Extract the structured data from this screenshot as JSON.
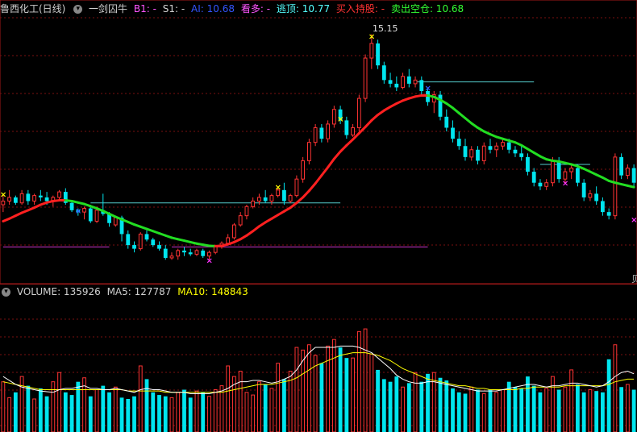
{
  "main_header": {
    "stock_name": "鲁西化工(日线)",
    "indicator_name": "一剑囚牛",
    "b1": "B1: -",
    "s1": "S1: -",
    "ai": "AI: 10.68",
    "kanduo": "看多: -",
    "taoding": "逃顶: 10.77",
    "mairu": "买入持股: -",
    "maichu": "卖出空仓: 10.68",
    "colors": {
      "stock": "#d0d0d0",
      "indicator": "#d0d0d0",
      "b1": "#ff55ff",
      "s1": "#d0d0d0",
      "ai": "#3355ff",
      "kanduo": "#ff55ff",
      "taoding": "#55ffff",
      "mairu": "#ff3333",
      "maichu": "#33ff33"
    }
  },
  "peak_label": "15.15",
  "volume_header": {
    "volume": "VOLUME: 135926",
    "ma5": "MA5: 127787",
    "ma10": "MA10: 148843"
  },
  "right_edge_glyph": "贝",
  "colors": {
    "up": "#ff3333",
    "down": "#00e5ee",
    "ma_red": "#ff2020",
    "ma_green": "#22dd22",
    "grid": "#7a1010",
    "border": "#a01818",
    "ma5": "#ffffff",
    "ma10": "#ffff00"
  },
  "chart_data": {
    "type": "candlestick",
    "y_min": 8.5,
    "y_max": 15.6,
    "candles": [
      [
        10.5,
        10.8,
        10.3,
        10.6
      ],
      [
        10.6,
        10.9,
        10.5,
        10.7
      ],
      [
        10.7,
        10.75,
        10.5,
        10.55
      ],
      [
        10.55,
        10.9,
        10.5,
        10.8
      ],
      [
        10.8,
        10.9,
        10.5,
        10.6
      ],
      [
        10.6,
        10.8,
        10.5,
        10.75
      ],
      [
        10.75,
        10.9,
        10.6,
        10.7
      ],
      [
        10.7,
        10.85,
        10.5,
        10.6
      ],
      [
        10.6,
        10.75,
        10.45,
        10.7
      ],
      [
        10.7,
        10.9,
        10.6,
        10.85
      ],
      [
        10.85,
        10.95,
        10.5,
        10.55
      ],
      [
        10.55,
        10.6,
        10.3,
        10.35
      ],
      [
        10.35,
        10.4,
        10.2,
        10.3
      ],
      [
        10.3,
        10.45,
        10.1,
        10.4
      ],
      [
        10.4,
        10.5,
        10.0,
        10.05
      ],
      [
        10.05,
        10.45,
        10.0,
        10.35
      ],
      [
        10.35,
        10.8,
        10.2,
        10.25
      ],
      [
        10.25,
        10.3,
        9.9,
        10.0
      ],
      [
        9.95,
        10.2,
        9.9,
        10.15
      ],
      [
        10.15,
        10.2,
        9.5,
        9.7
      ],
      [
        9.7,
        9.8,
        9.3,
        9.4
      ],
      [
        9.4,
        9.5,
        9.2,
        9.3
      ],
      [
        9.3,
        9.75,
        9.25,
        9.7
      ],
      [
        9.7,
        9.8,
        9.5,
        9.55
      ],
      [
        9.55,
        9.6,
        9.35,
        9.4
      ],
      [
        9.4,
        9.5,
        9.25,
        9.3
      ],
      [
        9.3,
        9.4,
        9.0,
        9.05
      ],
      [
        9.05,
        9.2,
        9.0,
        9.1
      ],
      [
        9.1,
        9.3,
        9.0,
        9.25
      ],
      [
        9.25,
        9.35,
        9.1,
        9.2
      ],
      [
        9.2,
        9.3,
        9.1,
        9.15
      ],
      [
        9.15,
        9.3,
        9.1,
        9.25
      ],
      [
        9.25,
        9.3,
        9.05,
        9.1
      ],
      [
        9.1,
        9.25,
        9.0,
        9.2
      ],
      [
        9.2,
        9.4,
        9.15,
        9.35
      ],
      [
        9.35,
        9.5,
        9.3,
        9.45
      ],
      [
        9.45,
        9.7,
        9.4,
        9.6
      ],
      [
        9.6,
        10.0,
        9.55,
        9.95
      ],
      [
        9.95,
        10.3,
        9.9,
        10.2
      ],
      [
        10.2,
        10.5,
        10.1,
        10.45
      ],
      [
        10.45,
        10.7,
        10.4,
        10.6
      ],
      [
        10.6,
        10.8,
        10.5,
        10.7
      ],
      [
        10.7,
        10.9,
        10.55,
        10.6
      ],
      [
        10.6,
        10.8,
        10.5,
        10.75
      ],
      [
        10.75,
        11.0,
        10.7,
        10.9
      ],
      [
        10.9,
        11.1,
        10.5,
        10.6
      ],
      [
        10.6,
        10.8,
        10.55,
        10.75
      ],
      [
        10.75,
        11.3,
        10.7,
        11.2
      ],
      [
        11.2,
        11.8,
        11.1,
        11.7
      ],
      [
        11.7,
        12.3,
        11.6,
        12.2
      ],
      [
        12.2,
        12.7,
        12.1,
        12.6
      ],
      [
        12.6,
        12.7,
        12.2,
        12.3
      ],
      [
        12.3,
        12.8,
        12.2,
        12.7
      ],
      [
        12.7,
        13.2,
        12.6,
        13.1
      ],
      [
        13.1,
        13.2,
        12.7,
        12.8
      ],
      [
        12.8,
        12.9,
        12.3,
        12.4
      ],
      [
        12.4,
        12.7,
        12.35,
        12.6
      ],
      [
        12.6,
        13.5,
        12.5,
        13.4
      ],
      [
        13.4,
        14.6,
        13.3,
        14.5
      ],
      [
        14.5,
        15.15,
        14.2,
        14.9
      ],
      [
        14.9,
        15.0,
        14.2,
        14.3
      ],
      [
        14.3,
        14.4,
        13.8,
        13.9
      ],
      [
        13.9,
        14.1,
        13.7,
        13.8
      ],
      [
        13.8,
        14.0,
        13.6,
        13.7
      ],
      [
        13.7,
        14.1,
        13.65,
        14.0
      ],
      [
        14.0,
        14.2,
        13.7,
        13.8
      ],
      [
        13.8,
        14.0,
        13.7,
        13.9
      ],
      [
        13.9,
        14.0,
        13.5,
        13.6
      ],
      [
        13.6,
        13.7,
        13.2,
        13.3
      ],
      [
        13.3,
        13.6,
        13.0,
        13.5
      ],
      [
        13.5,
        13.6,
        12.8,
        12.9
      ],
      [
        12.9,
        13.1,
        12.5,
        12.6
      ],
      [
        12.6,
        12.8,
        12.2,
        12.3
      ],
      [
        12.3,
        12.5,
        12.0,
        12.1
      ],
      [
        12.1,
        12.3,
        11.7,
        11.8
      ],
      [
        11.8,
        12.1,
        11.7,
        12.0
      ],
      [
        12.0,
        12.1,
        11.6,
        11.7
      ],
      [
        11.7,
        12.2,
        11.6,
        12.1
      ],
      [
        12.1,
        12.3,
        11.9,
        12.0
      ],
      [
        12.0,
        12.2,
        11.8,
        12.1
      ],
      [
        12.1,
        12.3,
        12.0,
        12.2
      ],
      [
        12.2,
        12.3,
        11.9,
        12.0
      ],
      [
        12.0,
        12.1,
        11.8,
        11.9
      ],
      [
        11.9,
        12.1,
        11.7,
        11.8
      ],
      [
        11.8,
        11.9,
        11.3,
        11.4
      ],
      [
        11.4,
        11.5,
        11.0,
        11.1
      ],
      [
        11.1,
        11.2,
        10.9,
        11.0
      ],
      [
        11.0,
        11.2,
        10.9,
        11.1
      ],
      [
        11.1,
        11.8,
        11.0,
        11.7
      ],
      [
        11.7,
        11.8,
        11.1,
        11.2
      ],
      [
        11.2,
        11.5,
        11.1,
        11.4
      ],
      [
        11.4,
        11.6,
        11.2,
        11.5
      ],
      [
        11.5,
        11.6,
        11.0,
        11.1
      ],
      [
        11.1,
        11.2,
        10.6,
        10.7
      ],
      [
        10.7,
        10.9,
        10.6,
        10.8
      ],
      [
        10.8,
        11.0,
        10.5,
        10.6
      ],
      [
        10.6,
        10.7,
        10.2,
        10.3
      ],
      [
        10.3,
        10.4,
        10.1,
        10.2
      ],
      [
        10.2,
        11.9,
        10.1,
        11.8
      ],
      [
        11.8,
        11.9,
        11.2,
        11.3
      ],
      [
        11.3,
        11.6,
        11.2,
        11.5
      ],
      [
        11.5,
        11.6,
        11.0,
        11.1
      ]
    ],
    "ma": [
      10.05,
      10.12,
      10.2,
      10.28,
      10.35,
      10.42,
      10.5,
      10.56,
      10.6,
      10.62,
      10.62,
      10.6,
      10.56,
      10.52,
      10.46,
      10.4,
      10.33,
      10.25,
      10.17,
      10.1,
      10.03,
      9.96,
      9.9,
      9.84,
      9.78,
      9.72,
      9.66,
      9.6,
      9.56,
      9.52,
      9.48,
      9.44,
      9.41,
      9.38,
      9.37,
      9.38,
      9.42,
      9.48,
      9.56,
      9.66,
      9.78,
      9.91,
      10.02,
      10.12,
      10.22,
      10.32,
      10.42,
      10.55,
      10.7,
      10.88,
      11.08,
      11.3,
      11.52,
      11.75,
      11.95,
      12.12,
      12.28,
      12.45,
      12.62,
      12.8,
      12.95,
      13.07,
      13.17,
      13.26,
      13.34,
      13.4,
      13.45,
      13.48,
      13.48,
      13.44,
      13.36,
      13.26,
      13.14,
      13.0,
      12.86,
      12.72,
      12.6,
      12.5,
      12.42,
      12.35,
      12.3,
      12.25,
      12.2,
      12.12,
      12.02,
      11.92,
      11.82,
      11.74,
      11.7,
      11.68,
      11.64,
      11.6,
      11.55,
      11.48,
      11.4,
      11.32,
      11.24,
      11.15,
      11.1,
      11.06,
      11.02,
      10.98
    ],
    "volume_max": 1000,
    "volumes": [
      380,
      260,
      300,
      420,
      350,
      250,
      330,
      270,
      380,
      450,
      300,
      280,
      380,
      410,
      270,
      320,
      350,
      300,
      340,
      260,
      250,
      270,
      500,
      400,
      300,
      280,
      270,
      260,
      300,
      320,
      260,
      310,
      300,
      270,
      320,
      350,
      500,
      420,
      460,
      300,
      280,
      380,
      360,
      330,
      520,
      400,
      460,
      640,
      620,
      660,
      580,
      520,
      650,
      700,
      640,
      560,
      560,
      760,
      780,
      590,
      470,
      400,
      380,
      420,
      340,
      370,
      450,
      380,
      440,
      450,
      410,
      390,
      330,
      300,
      290,
      340,
      320,
      290,
      320,
      300,
      320,
      380,
      340,
      330,
      420,
      350,
      300,
      330,
      420,
      320,
      340,
      470,
      360,
      300,
      320,
      310,
      300,
      550,
      660,
      340,
      360,
      320
    ],
    "ma5": [
      420,
      390,
      360,
      340,
      330,
      320,
      310,
      305,
      300,
      320,
      330,
      330,
      340,
      350,
      330,
      330,
      320,
      320,
      330,
      320,
      310,
      300,
      320,
      330,
      320,
      320,
      310,
      300,
      300,
      300,
      290,
      290,
      290,
      290,
      300,
      310,
      330,
      360,
      380,
      380,
      390,
      390,
      380,
      370,
      380,
      400,
      420,
      470,
      540,
      600,
      640,
      640,
      640,
      640,
      650,
      650,
      650,
      640,
      620,
      600,
      560,
      520,
      480,
      430,
      400,
      380,
      370,
      370,
      380,
      380,
      370,
      360,
      350,
      340,
      330,
      320,
      310,
      310,
      310,
      310,
      320,
      330,
      340,
      350,
      360,
      360,
      350,
      340,
      350,
      350,
      360,
      370,
      370,
      360,
      350,
      340,
      350,
      380,
      420,
      450,
      460,
      440
    ],
    "ma10": [
      380,
      370,
      360,
      350,
      340,
      330,
      320,
      320,
      320,
      320,
      320,
      320,
      320,
      320,
      320,
      320,
      320,
      320,
      320,
      320,
      310,
      310,
      310,
      310,
      310,
      310,
      300,
      300,
      300,
      300,
      300,
      300,
      300,
      300,
      300,
      300,
      310,
      320,
      330,
      340,
      350,
      360,
      360,
      360,
      370,
      380,
      390,
      410,
      440,
      470,
      500,
      520,
      540,
      560,
      580,
      590,
      600,
      600,
      600,
      590,
      580,
      560,
      540,
      510,
      480,
      460,
      440,
      420,
      400,
      390,
      380,
      370,
      360,
      350,
      350,
      340,
      330,
      330,
      320,
      320,
      320,
      320,
      320,
      330,
      330,
      340,
      340,
      340,
      340,
      340,
      350,
      350,
      350,
      350,
      350,
      350,
      350,
      360,
      380,
      390,
      400,
      400
    ]
  }
}
